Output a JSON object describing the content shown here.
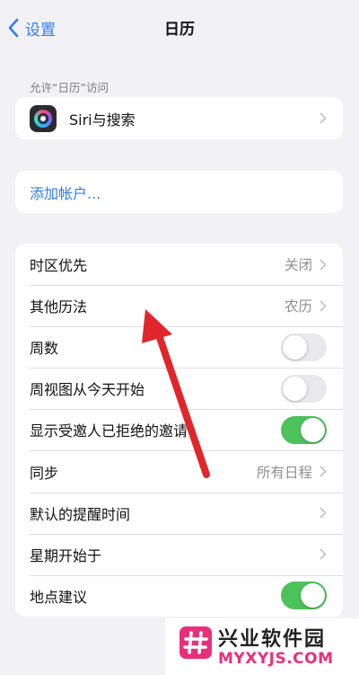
{
  "nav": {
    "back_label": "设置",
    "title": "日历"
  },
  "section_header": "允许“日历”访问",
  "siri_row": {
    "label": "Siri与搜索",
    "icon": "siri-icon"
  },
  "add_account": {
    "label": "添加帐户..."
  },
  "settings": [
    {
      "label": "时区优先",
      "value": "关闭",
      "type": "disclosure"
    },
    {
      "label": "其他历法",
      "value": "农历",
      "type": "disclosure"
    },
    {
      "label": "周数",
      "type": "toggle",
      "on": false
    },
    {
      "label": "周视图从今天开始",
      "type": "toggle",
      "on": false
    },
    {
      "label": "显示受邀人已拒绝的邀请",
      "type": "toggle",
      "on": true
    },
    {
      "label": "同步",
      "value": "所有日程",
      "type": "disclosure"
    },
    {
      "label": "默认的提醒时间",
      "value": "",
      "type": "disclosure"
    },
    {
      "label": "星期开始于",
      "value": "",
      "type": "disclosure"
    },
    {
      "label": "地点建议",
      "type": "toggle",
      "on": true
    }
  ],
  "watermark": {
    "text": "兴业软件园",
    "url": "MYXYJS.COM",
    "icon": "hash-logo-icon"
  },
  "colors": {
    "accent": "#2f7cf6",
    "toggle_on": "#4cc25a",
    "arrow": "#e0262b",
    "watermark": "#e8307a"
  }
}
